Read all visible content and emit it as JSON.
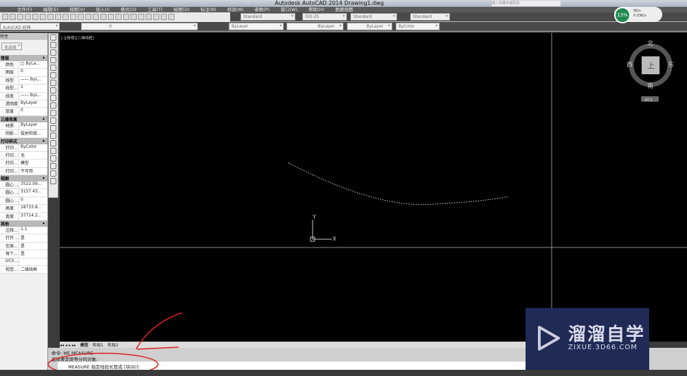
{
  "title": "Autodesk AutoCAD 2014    Drawing1.dwg",
  "search_placeholder": "键入关键字或短语",
  "menu": [
    "文件(F)",
    "编辑(E)",
    "视图(V)",
    "插入(I)",
    "格式(O)",
    "工具(T)",
    "绘图(D)",
    "标注(N)",
    "修改(M)",
    "参数(P)",
    "窗口(W)",
    "帮助(H)",
    "数据视图"
  ],
  "toolbar": {
    "text_style": "Standard",
    "dim_style": "ISO-25",
    "table_style": "Standard",
    "mleader_style": "Standard",
    "workspace": "AutoCAD 经典",
    "layer": "0",
    "color": "ByLayer",
    "linetype": "ByLayer",
    "lineweight": "ByLayer",
    "plotstyle": "ByColor"
  },
  "speed": {
    "percent": "13%",
    "up": "0K/s",
    "down": "0.03K/s"
  },
  "palette": {
    "title": "特性",
    "selection": "无选择",
    "sections": [
      {
        "name": "常规",
        "rows": [
          [
            "颜色",
            "□ ByLa..."
          ],
          [
            "图层",
            "0"
          ],
          [
            "线型",
            "—— ByL..."
          ],
          [
            "线型...",
            "1"
          ],
          [
            "线宽",
            "—— ByL..."
          ],
          [
            "透明度",
            "ByLayer"
          ],
          [
            "厚度",
            "0"
          ]
        ]
      },
      {
        "name": "三维效果",
        "rows": [
          [
            "材质",
            "ByLayer"
          ],
          [
            "阴影...",
            "投射和接..."
          ]
        ]
      },
      {
        "name": "打印样式",
        "rows": [
          [
            "打印...",
            "ByColor"
          ],
          [
            "打印...",
            "无"
          ],
          [
            "打印...",
            "模型"
          ],
          [
            "打印...",
            "不可用"
          ]
        ]
      },
      {
        "name": "视图",
        "rows": [
          [
            "圆心 ...",
            "3522.09..."
          ],
          [
            "圆心 ...",
            "3157.43..."
          ],
          [
            "圆心 ...",
            "0"
          ],
          [
            "高度",
            "18733.8..."
          ],
          [
            "宽度",
            "37714.2..."
          ]
        ]
      },
      {
        "name": "其他",
        "rows": [
          [
            "注释...",
            "1:1"
          ],
          [
            "打开 ...",
            "是"
          ],
          [
            "在原...",
            "是"
          ],
          [
            "每个...",
            "是"
          ],
          [
            "UCS ...",
            ""
          ],
          [
            "视觉...",
            "二维线框"
          ]
        ]
      }
    ]
  },
  "viewport_label": "[-][俯视][二维线框]",
  "viewcube": {
    "n": "北",
    "s": "南",
    "e": "东",
    "w": "西",
    "face": "上",
    "wcs": "WCS"
  },
  "ucs": {
    "x": "X",
    "y": "Y"
  },
  "tabs": [
    "模型",
    "布局1",
    "布局2"
  ],
  "command": {
    "history1": "命令: ME MEASURE",
    "history2": "选择要定距等分的对象:",
    "prompt": "MEASURE 指定线段长度或 [块(B)]:"
  },
  "watermark": {
    "name": "溜溜自学",
    "url": "ZIXUE.3D66.COM"
  }
}
